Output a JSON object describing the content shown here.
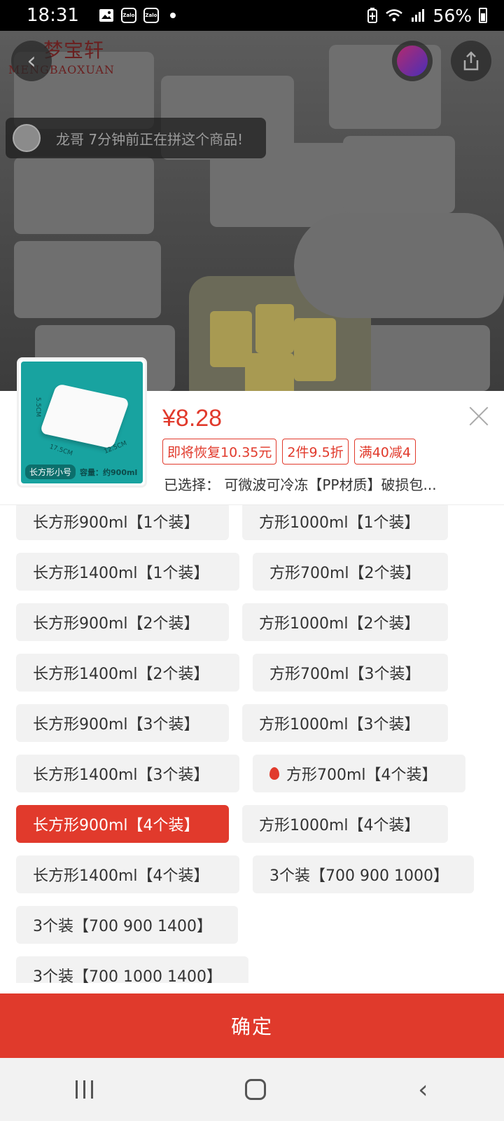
{
  "status_bar": {
    "time": "18:31",
    "notification_icons": [
      "gallery-icon",
      "zalo-icon",
      "zalo-icon",
      "dot-icon"
    ],
    "battery": "56%",
    "system_icons": [
      "battery-saver-icon",
      "wifi-icon",
      "signal-icon",
      "battery-icon"
    ]
  },
  "hero": {
    "logo_text_en": "MENGBAOXUAN",
    "logo_text_cn": "梦宝轩",
    "activity_banner": "龙哥 7分钟前正在拼这个商品!",
    "thumbnail_dims": [
      "5.5CM",
      "17.5CM",
      "12.5CM"
    ],
    "thumbnail_tag": "长方形小号",
    "thumbnail_caption": "容量：约900ml"
  },
  "product": {
    "price": "¥8.28",
    "promos": [
      "即将恢复10.35元",
      "2件9.5折",
      "满40减4"
    ],
    "selected": "已选择：  可微波可冷冻【PP材质】破损包..."
  },
  "options": [
    {
      "label": "长方形900ml【1个装】",
      "selected": false,
      "hot": false
    },
    {
      "label": "方形1000ml【1个装】",
      "selected": false,
      "hot": false
    },
    {
      "label": "长方形1400ml【1个装】",
      "selected": false,
      "hot": false
    },
    {
      "label": "方形700ml【2个装】",
      "selected": false,
      "hot": false
    },
    {
      "label": "长方形900ml【2个装】",
      "selected": false,
      "hot": false
    },
    {
      "label": "方形1000ml【2个装】",
      "selected": false,
      "hot": false
    },
    {
      "label": "长方形1400ml【2个装】",
      "selected": false,
      "hot": false
    },
    {
      "label": "方形700ml【3个装】",
      "selected": false,
      "hot": false
    },
    {
      "label": "长方形900ml【3个装】",
      "selected": false,
      "hot": false
    },
    {
      "label": "方形1000ml【3个装】",
      "selected": false,
      "hot": false
    },
    {
      "label": "长方形1400ml【3个装】",
      "selected": false,
      "hot": false
    },
    {
      "label": "方形700ml【4个装】",
      "selected": false,
      "hot": true
    },
    {
      "label": "长方形900ml【4个装】",
      "selected": true,
      "hot": false
    },
    {
      "label": "方形1000ml【4个装】",
      "selected": false,
      "hot": false
    },
    {
      "label": "长方形1400ml【4个装】",
      "selected": false,
      "hot": false
    },
    {
      "label": "3个装【700 900 1000】",
      "selected": false,
      "hot": false
    },
    {
      "label": "3个装【700 900 1400】",
      "selected": false,
      "hot": false
    },
    {
      "label": "3个装【700 1000 1400】",
      "selected": false,
      "hot": false
    }
  ],
  "confirm_label": "确定",
  "colors": {
    "accent": "#e13a2c",
    "overlay": "#4a4a4a",
    "option_bg": "#f2f2f2"
  }
}
